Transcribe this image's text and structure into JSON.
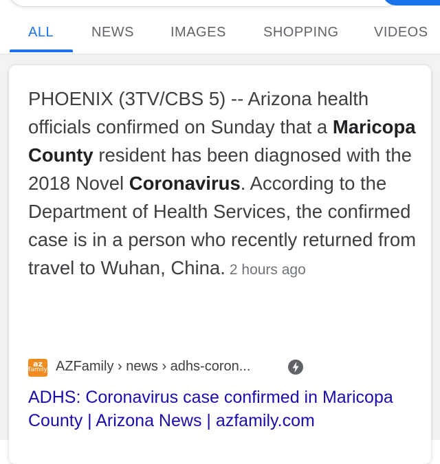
{
  "tabs": [
    {
      "label": "ALL",
      "active": true
    },
    {
      "label": "NEWS"
    },
    {
      "label": "IMAGES"
    },
    {
      "label": "SHOPPING"
    },
    {
      "label": "VIDEOS"
    }
  ],
  "result": {
    "snippet": {
      "part1": "PHOENIX (3TV/CBS 5) -- Arizona health officials confirmed on Sunday that a ",
      "bold1": "Maricopa County",
      "part2": " resident has been diagnosed with the 2018 Novel ",
      "bold2": "Coronavirus",
      "part3": ". According to the Department of Health Services, the confirmed case is in a person who recently returned from travel to Wuhan, China.",
      "time": "2 hours ago"
    },
    "source": {
      "favicon_text_top": "az",
      "favicon_text_bottom": "family",
      "breadcrumb": "AZFamily › news › adhs-coron...",
      "amp_icon": "lightning-bolt-icon"
    },
    "title": "ADHS: Coronavirus case confirmed in Maricopa County | Arizona News | azfamily.com"
  },
  "colors": {
    "accent": "#1a73e8",
    "link": "#1a0dab",
    "favicon": "#f28b1e"
  }
}
